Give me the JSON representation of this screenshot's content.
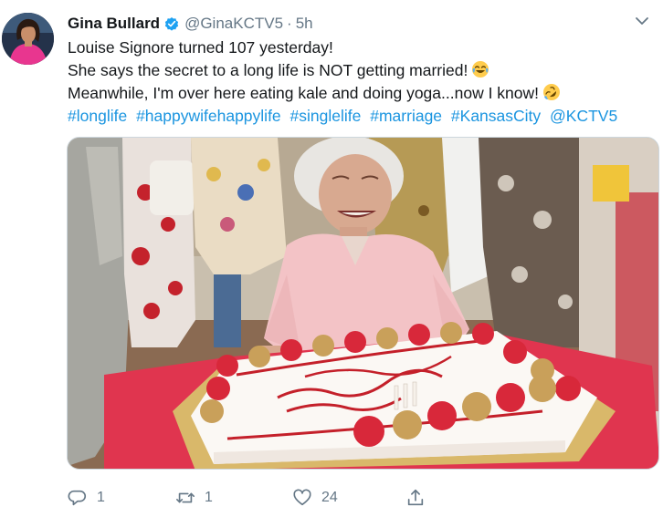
{
  "tweet": {
    "author": {
      "name": "Gina Bullard",
      "handle": "@GinaKCTV5",
      "time": "5h",
      "separator": "·"
    },
    "text": {
      "line1": "Louise Signore turned 107 yesterday!",
      "line2": "She says the secret to a long life is NOT getting married!",
      "line3": "Meanwhile, I'm over here eating kale and doing yoga...now I know!",
      "hashtags": [
        "#longlife",
        "#happywifehappylife",
        "#singlelife",
        "#marriage",
        "#KansasCity",
        "@KCTV5"
      ]
    },
    "icons": {
      "verified": "verified-badge-icon",
      "caret": "chevron-down-icon",
      "emoji1": "face-with-tears-of-joy-icon",
      "emoji2": "rolling-on-floor-laughing-icon",
      "reply": "reply-icon",
      "retweet": "retweet-icon",
      "like": "heart-icon",
      "share": "share-icon"
    },
    "stats": {
      "replies": "1",
      "retweets": "1",
      "likes": "24"
    },
    "colors": {
      "link": "#1b95e0",
      "verified": "#1da1f2",
      "muted": "#657786"
    },
    "media": {
      "cake_text": "107"
    }
  }
}
